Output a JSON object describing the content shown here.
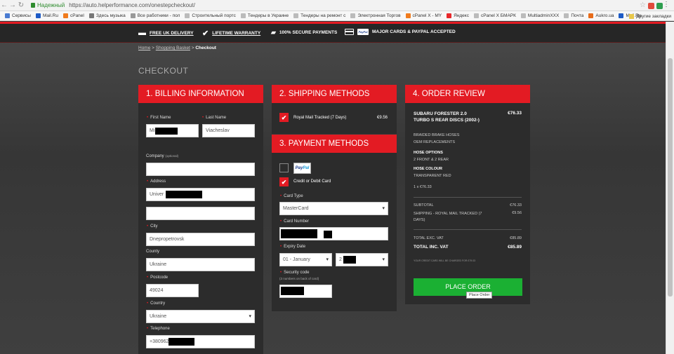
{
  "browser": {
    "secure_label": "Надежный",
    "url": "https://auto.helperformance.com/onestepcheckout/",
    "bookmarks": [
      "Сервисы",
      "Mail.Ru",
      "cPanel",
      "Здесь музыка",
      "Все работники - пол",
      "Строительный портс",
      "Тендеры в Украине",
      "Тендеры на ремонт с",
      "Электронная Торгов",
      "cPanel X - MY",
      "Яндекс",
      "cPanel X БМАРК",
      "MultiadminXXX",
      "Почта",
      "Aukro.ua",
      "Mail.Ru"
    ],
    "other_bookmarks": "Другие закладки"
  },
  "trust": {
    "delivery": "FREE UK DELIVERY",
    "warranty": "LIFETIME WARRANTY",
    "secure": "100% SECURE PAYMENTS",
    "cards": "MAJOR CARDS & PAYPAL ACCEPTED",
    "paypal_mini": "PayPal"
  },
  "breadcrumb": {
    "home": "Home",
    "basket": "Shopping Basket",
    "sep": ">",
    "current": "Checkout"
  },
  "page_title": "CHECKOUT",
  "billing": {
    "title": "1. BILLING INFORMATION",
    "first_name_label": "First Name",
    "first_name_value": "Mi",
    "last_name_label": "Last Name",
    "last_name_value": "Viacheslav",
    "company_label": "Company",
    "company_optional": "(optional)",
    "address_label": "Address",
    "address_value": "Univer",
    "city_label": "City",
    "city_value": "Dnepropetrovsk",
    "county_label": "County",
    "county_value": "Ukraine",
    "postcode_label": "Postcode",
    "postcode_value": "49024",
    "country_label": "Country",
    "country_value": "Ukraine",
    "telephone_label": "Telephone",
    "telephone_value": "+380962"
  },
  "shipping": {
    "title": "2. SHIPPING METHODS",
    "method_label": "Royal Mail Tracked (7 Days)",
    "method_price": "€9.56"
  },
  "payment": {
    "title": "3. PAYMENT METHODS",
    "paypal_logo_a": "Pay",
    "paypal_logo_b": "Pal",
    "card_label": "Credit or Debit Card",
    "card_type_label": "Card Type",
    "card_type_value": "MasterCard",
    "card_number_label": "Card Number",
    "expiry_label": "Expiry Date",
    "expiry_month": "01 - January",
    "expiry_year": "2",
    "security_label": "Security code",
    "security_hint": "(3 numbers on back of card)"
  },
  "review": {
    "title": "4. ORDER REVIEW",
    "product_name": "SUBARU FORESTER 2.0 TURBO S REAR DISCS (2002-)",
    "product_price": "€76.33",
    "product_desc_1": "BRAIDED BRAKE HOSES",
    "product_desc_2": "OEM REPLACEMENTS",
    "hose_options_label": "HOSE OPTIONS",
    "hose_options_value": "2 FRONT & 2 REAR",
    "hose_colour_label": "HOSE COLOUR",
    "hose_colour_value": "TRANSPARENT RED",
    "qty_line": "1 x €76.33",
    "subtotal_label": "SUBTOTAL",
    "subtotal_value": "€76.33",
    "shipping_label": "SHIPPING - ROYAL MAIL TRACKED (7 DAYS)",
    "shipping_value": "€9.56",
    "total_ex_label": "TOTAL EXC. VAT",
    "total_ex_value": "€85.89",
    "total_inc_label": "TOTAL INC. VAT",
    "total_inc_value": "€85.89",
    "charge_note": "YOUR CREDIT CARD WILL BE CHARGED FOR £79.03",
    "place_order": "PLACE ORDER",
    "tooltip": "Place Order"
  },
  "colors": {
    "accent": "#e31b23",
    "button": "#1bb033",
    "panel": "#2c2c2c"
  }
}
